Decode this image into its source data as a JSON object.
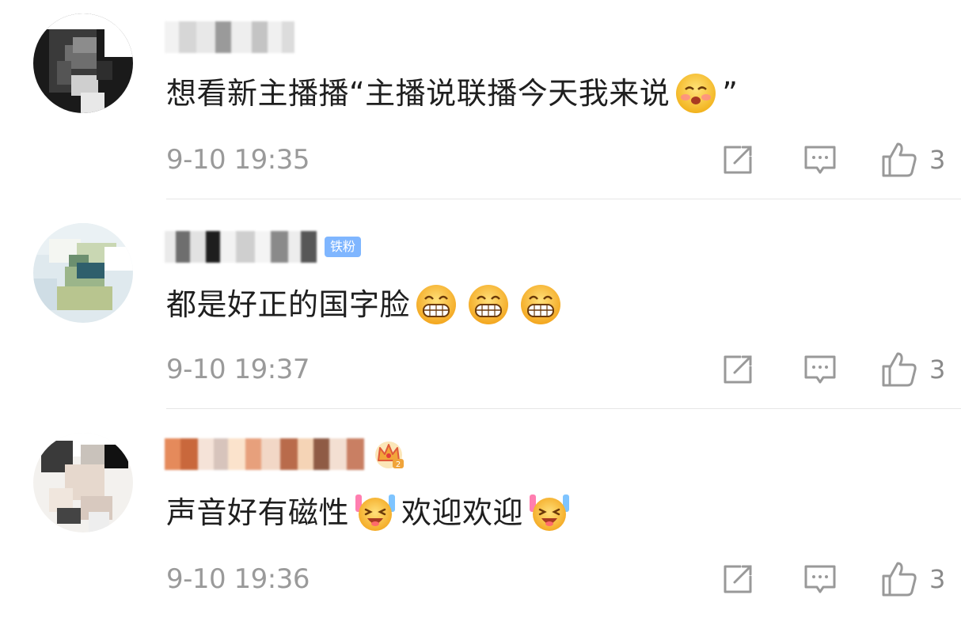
{
  "comments": [
    {
      "text": "想看新主播播“主播说联播今天我来说",
      "text_suffix": "”",
      "emojis": [
        "blush-emoji"
      ],
      "badge": "",
      "time": "9-10 19:35",
      "likes": "3"
    },
    {
      "text": "都是好正的国字脸",
      "text_suffix": "",
      "emojis": [
        "grin-emoji",
        "grin-emoji",
        "grin-emoji"
      ],
      "badge": "铁粉",
      "time": "9-10 19:37",
      "likes": "3"
    },
    {
      "text": "声音好有磁性",
      "text_mid": "欢迎欢迎",
      "text_suffix": "",
      "emojis": [
        "cheer-emoji",
        "cheer-emoji"
      ],
      "badge": "",
      "time": "9-10 19:36",
      "likes": "3"
    }
  ],
  "colors": {
    "text": "#1f1f1f",
    "meta": "#9a9a9a",
    "badge_bg": "#7fb6ff",
    "divider": "#e6e6e6"
  },
  "icons": [
    "share-icon",
    "comment-icon",
    "thumbs-up-icon",
    "crown-icon"
  ]
}
